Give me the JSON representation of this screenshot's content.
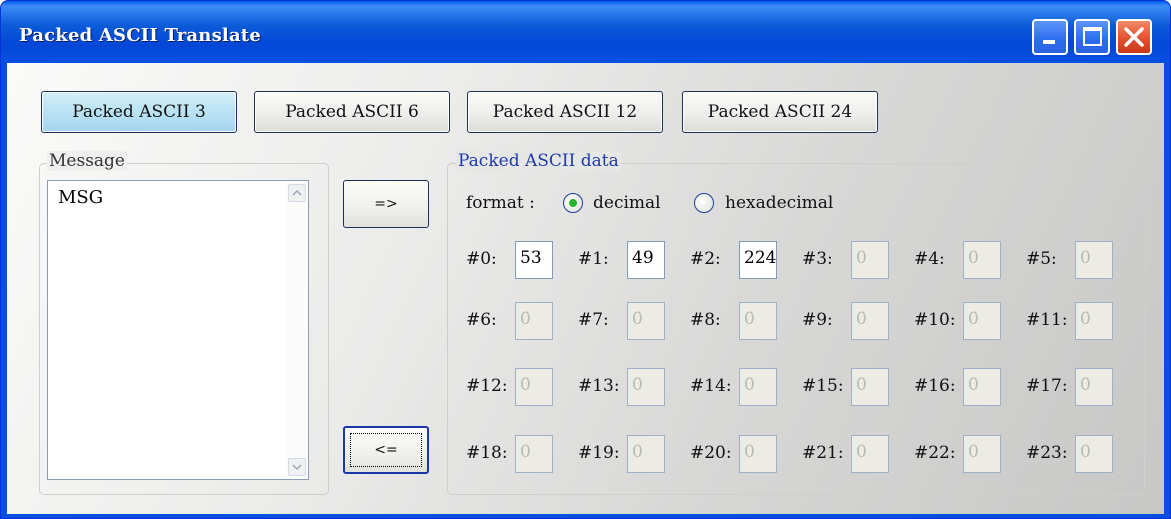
{
  "window": {
    "title": "Packed ASCII Translate"
  },
  "tabs": [
    {
      "label": "Packed ASCII 3",
      "active": true
    },
    {
      "label": "Packed ASCII 6",
      "active": false
    },
    {
      "label": "Packed ASCII 12",
      "active": false
    },
    {
      "label": "Packed ASCII 24",
      "active": false
    }
  ],
  "message": {
    "group_label": "Message",
    "value": "MSG"
  },
  "actions": {
    "encode_label": "=>",
    "decode_label": "<="
  },
  "packed": {
    "group_label": "Packed ASCII data",
    "format_label": "format :",
    "options": [
      {
        "label": "decimal",
        "selected": true
      },
      {
        "label": "hexadecimal",
        "selected": false
      }
    ],
    "cells": [
      {
        "label": "#0:",
        "value": "53",
        "enabled": true
      },
      {
        "label": "#1:",
        "value": "49",
        "enabled": true
      },
      {
        "label": "#2:",
        "value": "224",
        "enabled": true
      },
      {
        "label": "#3:",
        "value": "0",
        "enabled": false
      },
      {
        "label": "#4:",
        "value": "0",
        "enabled": false
      },
      {
        "label": "#5:",
        "value": "0",
        "enabled": false
      },
      {
        "label": "#6:",
        "value": "0",
        "enabled": false
      },
      {
        "label": "#7:",
        "value": "0",
        "enabled": false
      },
      {
        "label": "#8:",
        "value": "0",
        "enabled": false
      },
      {
        "label": "#9:",
        "value": "0",
        "enabled": false
      },
      {
        "label": "#10:",
        "value": "0",
        "enabled": false
      },
      {
        "label": "#11:",
        "value": "0",
        "enabled": false
      },
      {
        "label": "#12:",
        "value": "0",
        "enabled": false
      },
      {
        "label": "#13:",
        "value": "0",
        "enabled": false
      },
      {
        "label": "#14:",
        "value": "0",
        "enabled": false
      },
      {
        "label": "#15:",
        "value": "0",
        "enabled": false
      },
      {
        "label": "#16:",
        "value": "0",
        "enabled": false
      },
      {
        "label": "#17:",
        "value": "0",
        "enabled": false
      },
      {
        "label": "#18:",
        "value": "0",
        "enabled": false
      },
      {
        "label": "#19:",
        "value": "0",
        "enabled": false
      },
      {
        "label": "#20:",
        "value": "0",
        "enabled": false
      },
      {
        "label": "#21:",
        "value": "0",
        "enabled": false
      },
      {
        "label": "#22:",
        "value": "0",
        "enabled": false
      },
      {
        "label": "#23:",
        "value": "0",
        "enabled": false
      }
    ]
  },
  "colors": {
    "titlebar": "#0a4ee0",
    "group_label_blue": "#1c3aa9",
    "active_tab": "#b5e0f2",
    "radio_dot": "#2bb52e"
  }
}
